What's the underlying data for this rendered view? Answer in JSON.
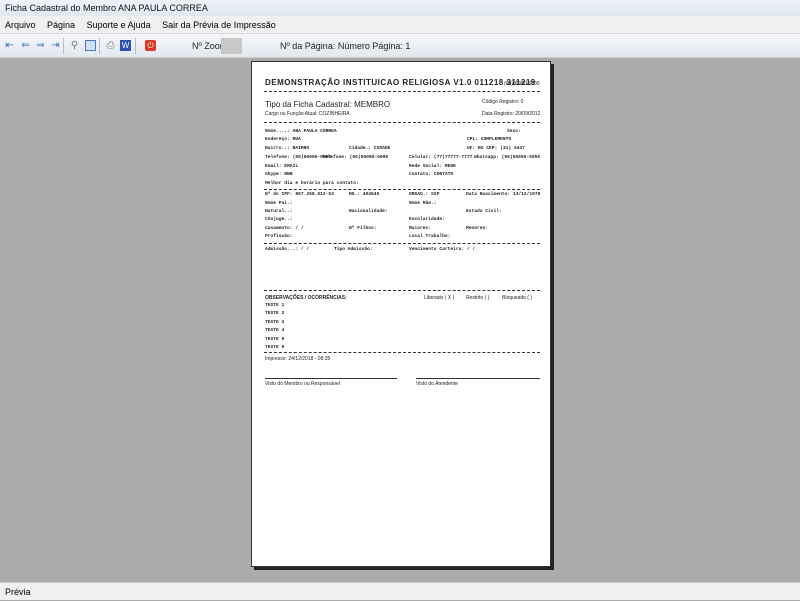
{
  "window": {
    "title": "Ficha Cadastral do Membro ANA PAULA CORREA"
  },
  "menu": [
    "Arquivo",
    "Página",
    "Suporte e Ajuda",
    "Sair da Prévia de Impressão"
  ],
  "toolbar": {
    "zoom_label": "Nº Zoom",
    "page_label": "Nº da Página: Número Página: 1"
  },
  "report": {
    "title": "DEMONSTRAÇÃO INSTITUICAO RELIGIOSA V1.0 011218 311219",
    "phone": "(00)00000-0000",
    "tipo": "Tipo da Ficha Cadastral: MEMBRO",
    "cargo": "Cargo ou Função Atual: COZINHEIRA",
    "codigo": "Código Registro:   0",
    "data_registro": "Data Registro: 20/09/2012",
    "fields": [
      [
        "Nome....: ANA PAULA CORREA",
        "Sexo:"
      ],
      [
        "Endereço: RUA",
        "CPL: COMPLEMENTO"
      ],
      [
        "Bairro..: BAIRRO",
        "Cidade.: CIDADE",
        "UF: RS  CEP: (31) 3447"
      ],
      [
        "Telefone: (00)00000-0000",
        "Telefone: (00)00000-0000",
        "Celular: (77)77777-7777",
        "Whatsapp: (55)55555-5555"
      ],
      [
        "Email: EMAIL",
        "Rede Social: REDE"
      ],
      [
        "Skype: NNN",
        "Contato: CONTATO"
      ],
      [
        "Melhor dia e horário para contato:"
      ],
      [
        "Nº do CPF: 857.258.612-53",
        "RG.: 404545",
        "ORGAO.: SSP",
        "Data Nascimento: 13/12/1978"
      ],
      [
        "Nome Pai.:",
        "Nome Mãe.:"
      ],
      [
        "Natural..:",
        "Nacionalidade:",
        "Estado Civil:"
      ],
      [
        "Cônjuge..:",
        "Escolaridade:"
      ],
      [
        "Casamento:  /  /",
        "Nº Filhos:",
        "Maiores:",
        "Menores:"
      ],
      [
        "Profissão:",
        "Local Trabalho:"
      ],
      [
        "Admissão...:  /  /",
        "Tipo Admissão:",
        "Vencimento Carteira:  /  /"
      ]
    ],
    "obs_label": "OBSERVAÇÕES / OCORRÊNCIAS:",
    "status_options": [
      "Liberado ( X )",
      "Restrito (  )",
      "Bloqueado (  )"
    ],
    "obs_lines": [
      "TESTE 1",
      "TESTE 2",
      "TESTE 3",
      "TESTE 4",
      "TESTE 5",
      "TESTE 6"
    ],
    "impresso": "Impresso: 24/12/2018 - 08:35",
    "sign_member": "Visto do Membro ou Responsável",
    "sign_attendant": "Visto do Atendente"
  },
  "statusbar": {
    "text": "Prévia"
  }
}
